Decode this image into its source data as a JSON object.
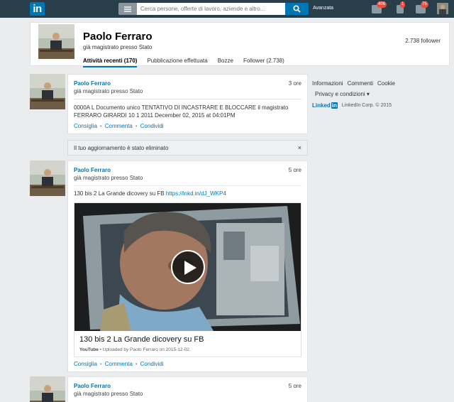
{
  "nav": {
    "logo": "in",
    "search_placeholder": "Cerca persone, offerte di lavoro, aziende e altro...",
    "advanced": "Avanzata",
    "badges": {
      "messages": "406",
      "notifications": "1",
      "add_connections": "75"
    },
    "brand_color": "#0077b5"
  },
  "profile": {
    "name": "Paolo Ferraro",
    "headline": "già magistrato presso Stato",
    "followers": "2.738 follower",
    "tabs": [
      "Attività recenti (170)",
      "Pubblicazione effettuata",
      "Bozze",
      "Follower (2.738)"
    ]
  },
  "posts": [
    {
      "author": "Paolo Ferraro",
      "headline": "già magistrato presso Stato",
      "time": "3 ore",
      "text": "0000A L Documento unico TENTATIVO DI INCASTRARE E BLOCCARE il magistrato FERRARO GIRARDI 10 1 2011 December 02, 2015 at 04:01PM",
      "actions": [
        "Consiglia",
        "Commenta",
        "Condividi"
      ]
    },
    {
      "author": "Paolo Ferraro",
      "headline": "già magistrato presso Stato",
      "time": "5 ore",
      "text": "130 bis 2 La Grande dicovery su FB",
      "link": "https://lnkd.in/dJ_WKP4",
      "video": {
        "title": "130 bis 2 La Grande dicovery su FB",
        "source": "YouTube",
        "meta": "• Uploaded by Paolo Ferraro on 2015-12-02."
      },
      "actions": [
        "Consiglia",
        "Commenta",
        "Condividi"
      ]
    },
    {
      "author": "Paolo Ferraro",
      "headline": "già magistrato presso Stato",
      "time": "5 ore"
    }
  ],
  "deleted_notice": "Il tuo aggiornamento è stato eliminato",
  "deleted_close": "×",
  "rail": {
    "links": [
      "Informazioni",
      "Commenti",
      "Cookie"
    ],
    "privacy": "Privacy e condizioni ▾",
    "brand_a": "Linked",
    "brand_b": "in",
    "corp": "LinkedIn Corp. © 2015"
  }
}
